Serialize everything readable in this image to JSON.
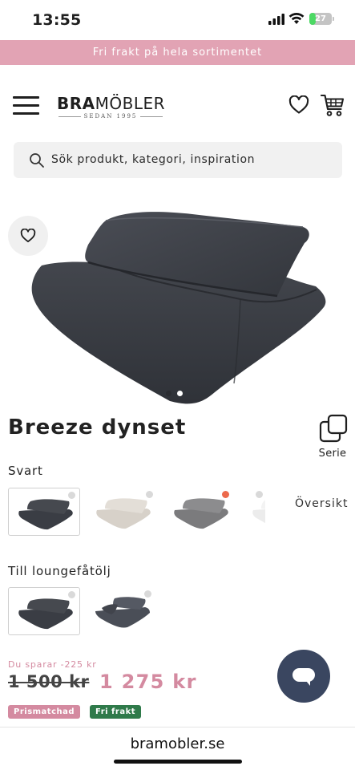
{
  "status_bar": {
    "time": "13:55",
    "battery": "27",
    "battery_fraction": 0.27,
    "battery_color": "#4cd964"
  },
  "promo": {
    "text": "Fri frakt på hela sortimentet",
    "background": "#e2a3b4"
  },
  "header": {
    "logo_bold": "BRA",
    "logo_regular": "MÖBLER",
    "logo_tagline": "SEDAN 1995",
    "search_placeholder": "Sök produkt, kategori, inspiration"
  },
  "product": {
    "title": "Breeze dynset",
    "serie_label": "Serie",
    "image_slide_count": 2,
    "active_slide": 2
  },
  "variants": {
    "color_label": "Svart",
    "overview_label": "Översikt",
    "color_options": [
      {
        "name": "svart",
        "selected": true,
        "stock_dot": "#d9d9d9"
      },
      {
        "name": "ljus",
        "selected": false,
        "stock_dot": "#d9d9d9"
      },
      {
        "name": "grå",
        "selected": false,
        "stock_dot": "#ec6a4c"
      },
      {
        "name": "vit",
        "selected": false,
        "stock_dot": "#d9d9d9"
      }
    ],
    "chair_label": "Till loungefåtölj",
    "chair_options": [
      {
        "name": "loungefåtölj-1",
        "selected": true
      },
      {
        "name": "loungefåtölj-2",
        "selected": false
      }
    ]
  },
  "price": {
    "savings": "Du sparar -225 kr",
    "old": "1 500 kr",
    "new": "1 275 kr",
    "accent": "#d48aa0"
  },
  "badges": [
    {
      "label": "Prismatchad",
      "color": "#d48aa0"
    },
    {
      "label": "Fri frakt",
      "color": "#2f7a4a"
    }
  ],
  "chat": {
    "icon": "chat-bubble-icon",
    "color": "#3a4660"
  },
  "browser": {
    "url": "bramobler.se"
  }
}
